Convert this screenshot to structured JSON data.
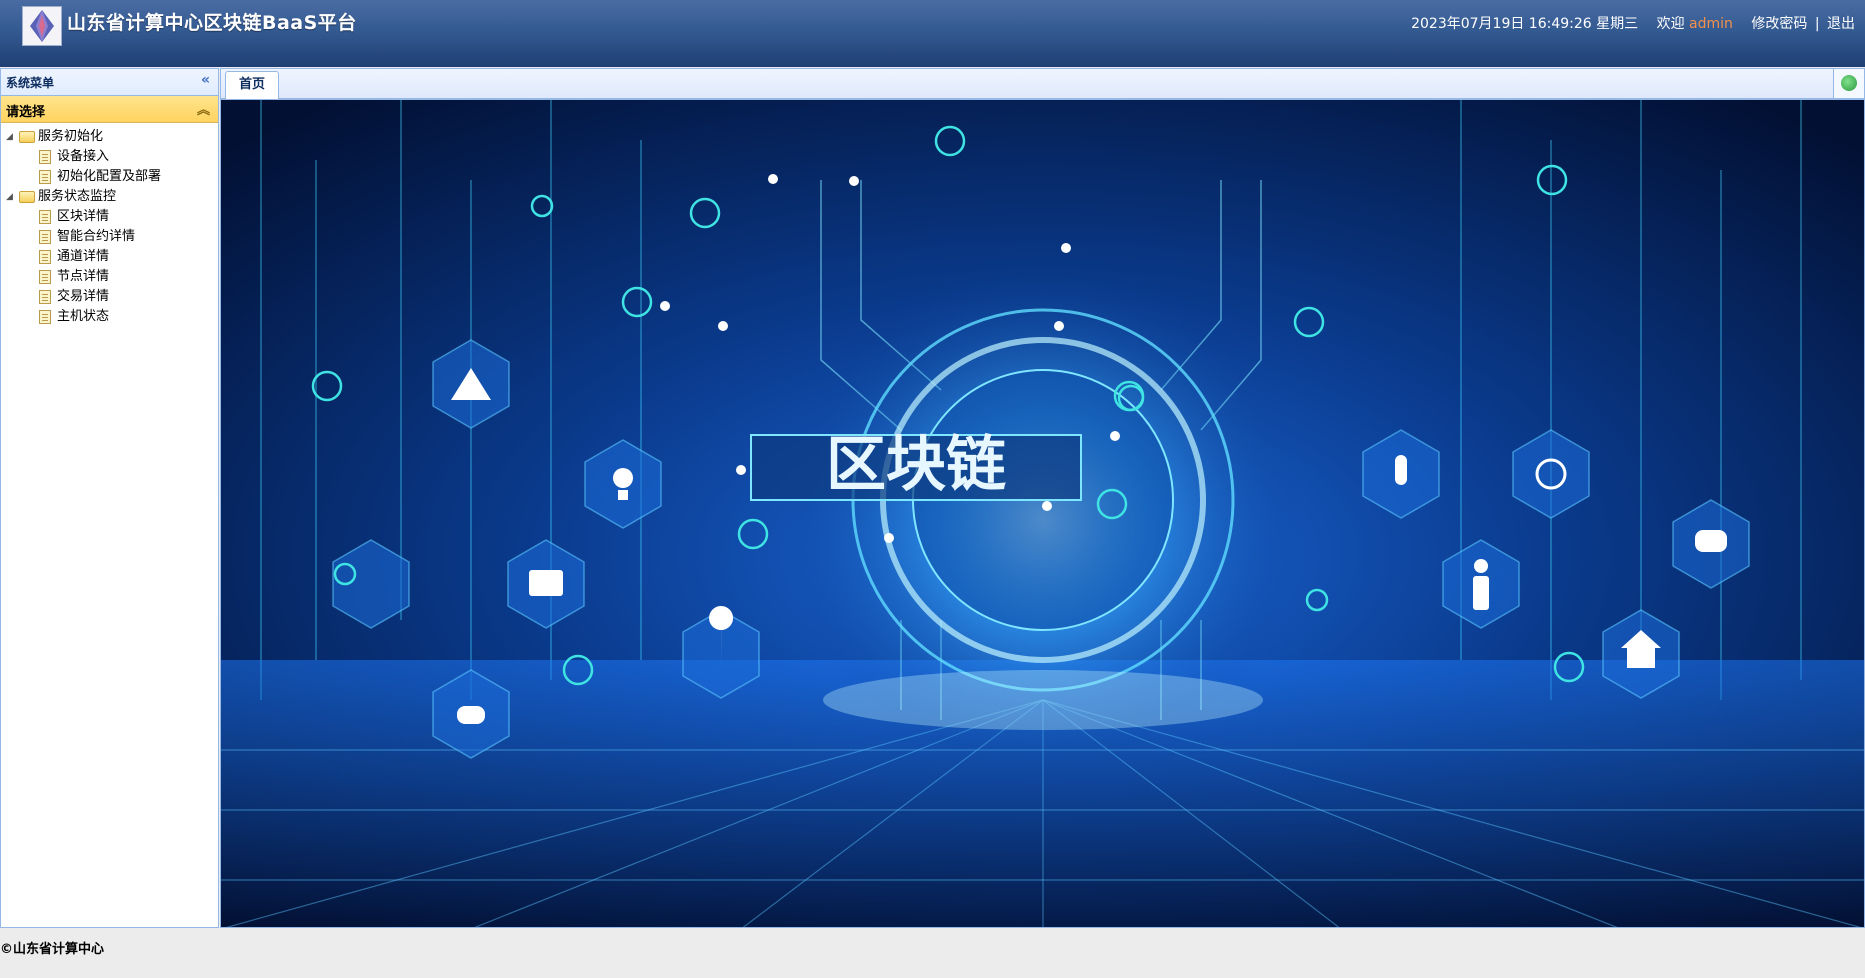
{
  "header": {
    "title": "山东省计算中心区块链BaaS平台",
    "datetime": "2023年07月19日 16:49:26 星期三",
    "welcome": "欢迎",
    "user": "admin",
    "change_password": "修改密码",
    "separator": "|",
    "logout": "退出"
  },
  "sidebar": {
    "title": "系统菜单",
    "collapse_glyph": "«",
    "accordion_title": "请选择",
    "accordion_glyph": "︽",
    "tree": [
      {
        "label": "服务初始化",
        "children": [
          {
            "label": "设备接入"
          },
          {
            "label": "初始化配置及部署"
          }
        ]
      },
      {
        "label": "服务状态监控",
        "children": [
          {
            "label": "区块详情"
          },
          {
            "label": "智能合约详情"
          },
          {
            "label": "通道详情"
          },
          {
            "label": "节点详情"
          },
          {
            "label": "交易详情"
          },
          {
            "label": "主机状态"
          }
        ]
      }
    ]
  },
  "tabs": [
    {
      "label": "首页"
    }
  ],
  "content": {
    "banner_text": "区块链",
    "icon_names": [
      "bitcoin-icon",
      "lightbulb-icon",
      "folder-icon",
      "location-pin-icon",
      "cloud-download-icon",
      "triangle-logo-icon",
      "phone-icon",
      "back-arrow-icon",
      "person-icon",
      "home-icon",
      "cloud-upload-icon"
    ],
    "colors": {
      "background": "#03163f",
      "glow": "#3fd3ff",
      "accent": "#1e90ff"
    }
  },
  "footer": {
    "copyright": "©山东省计算中心"
  }
}
